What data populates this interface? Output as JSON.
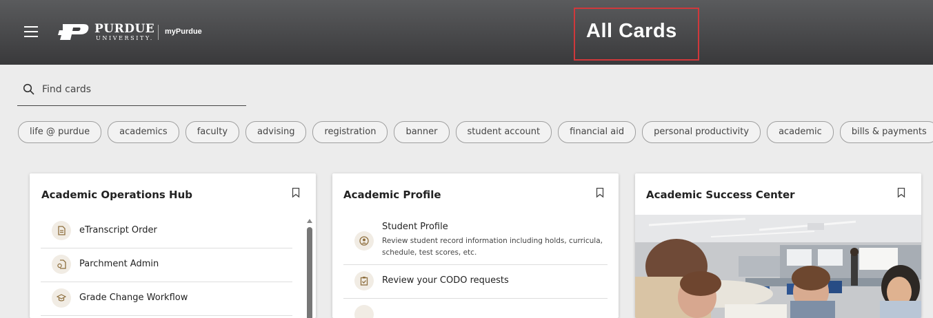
{
  "header": {
    "logo_word": "PURDUE",
    "logo_sub": "UNIVERSITY.",
    "app_name": "myPurdue",
    "title": "All Cards"
  },
  "search": {
    "placeholder": "Find cards",
    "value": ""
  },
  "chips": [
    "life @ purdue",
    "academics",
    "faculty",
    "advising",
    "registration",
    "banner",
    "student account",
    "financial aid",
    "personal productivity",
    "academic",
    "bills & payments"
  ],
  "cards": {
    "ops": {
      "title": "Academic Operations Hub",
      "items": [
        "eTranscript Order",
        "Parchment Admin",
        "Grade Change Workflow"
      ]
    },
    "profile": {
      "title": "Academic Profile",
      "items": [
        {
          "label": "Student Profile",
          "description": "Review student record information including holds, curricula, schedule, test scores, etc."
        },
        {
          "label": "Review your CODO requests"
        }
      ]
    },
    "success": {
      "title": "Academic Success Center"
    }
  },
  "colors": {
    "header_bg": "#3e3e40",
    "highlight_box": "#d0383b",
    "icon_bg": "#f1ece4",
    "icon_fg": "#8e6f3e"
  }
}
